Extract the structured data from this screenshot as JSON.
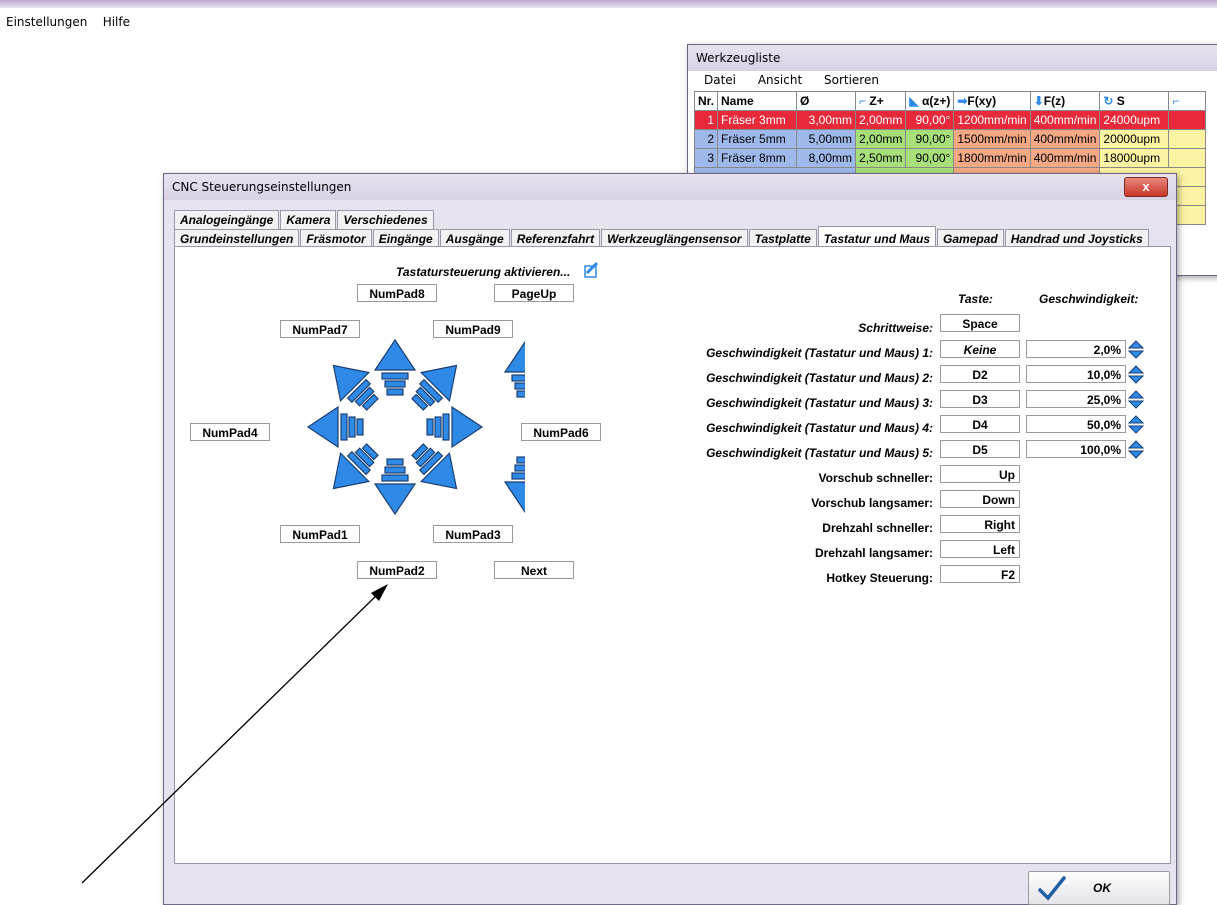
{
  "menubar": {
    "items": [
      "Einstellungen",
      "Hilfe"
    ]
  },
  "tool_window": {
    "title": "Werkzeugliste",
    "menu": [
      "Datei",
      "Ansicht",
      "Sortieren"
    ],
    "headers": [
      "Nr.",
      "Name",
      "Ø",
      "Z+",
      "α(z+)",
      "F(xy)",
      "F(z)",
      "S"
    ],
    "rows": [
      [
        "1",
        "Fräser 3mm",
        "3,00mm",
        "2,00mm",
        "90,00°",
        "1200mm/min",
        "400mm/min",
        "24000upm"
      ],
      [
        "2",
        "Fräser 5mm",
        "5,00mm",
        "2,00mm",
        "90,00°",
        "1500mm/min",
        "400mm/min",
        "20000upm"
      ],
      [
        "3",
        "Fräser 8mm",
        "8,00mm",
        "2,50mm",
        "90,00°",
        "1800mm/min",
        "400mm/min",
        "18000upm"
      ]
    ],
    "colors": {
      "selected_row": "#e8293a",
      "col_diameter": "#9fb8ea",
      "col_z": "#a7e07a",
      "col_feed": "#f4a984",
      "col_speed": "#fbf3a2"
    }
  },
  "dialog": {
    "title": "CNC Steuerungseinstellungen",
    "close_label": "x",
    "tabs_row1": [
      "Analogeingänge",
      "Kamera",
      "Verschiedenes"
    ],
    "tabs_row2": [
      "Grundeinstellungen",
      "Fräsmotor",
      "Eingänge",
      "Ausgänge",
      "Referenzfahrt",
      "Werkzeuglängensensor",
      "Tastplatte",
      "Tastatur und Maus",
      "Gamepad",
      "Handrad und Joysticks"
    ],
    "active_tab": "Tastatur und Maus",
    "enable_label": "Tastatursteuerung aktivieren...",
    "enable_checked": true,
    "arrow_color": "#2e8ae6",
    "keys": {
      "numpad8": "NumPad8",
      "pageup": "PageUp",
      "numpad7": "NumPad7",
      "numpad9": "NumPad9",
      "numpad4": "NumPad4",
      "numpad6": "NumPad6",
      "numpad1": "NumPad1",
      "numpad3": "NumPad3",
      "numpad2": "NumPad2",
      "next": "Next"
    },
    "col_key": "Taste:",
    "col_speed": "Geschwindigkeit:",
    "step_label": "Schrittweise:",
    "step_key": "Space",
    "speeds": [
      {
        "label": "Geschwindigkeit (Tastatur und Maus) 1:",
        "key": "Keine",
        "value": "2,0%"
      },
      {
        "label": "Geschwindigkeit (Tastatur und Maus) 2:",
        "key": "D2",
        "value": "10,0%"
      },
      {
        "label": "Geschwindigkeit (Tastatur und Maus) 3:",
        "key": "D3",
        "value": "25,0%"
      },
      {
        "label": "Geschwindigkeit (Tastatur und Maus) 4:",
        "key": "D4",
        "value": "50,0%"
      },
      {
        "label": "Geschwindigkeit (Tastatur und Maus) 5:",
        "key": "D5",
        "value": "100,0%"
      }
    ],
    "hotkeys": [
      {
        "label": "Vorschub schneller:",
        "key": "Up"
      },
      {
        "label": "Vorschub langsamer:",
        "key": "Down"
      },
      {
        "label": "Drehzahl schneller:",
        "key": "Right"
      },
      {
        "label": "Drehzahl langsamer:",
        "key": "Left"
      },
      {
        "label": "Hotkey Steuerung:",
        "key": "F2"
      }
    ],
    "ok_label": "OK"
  }
}
